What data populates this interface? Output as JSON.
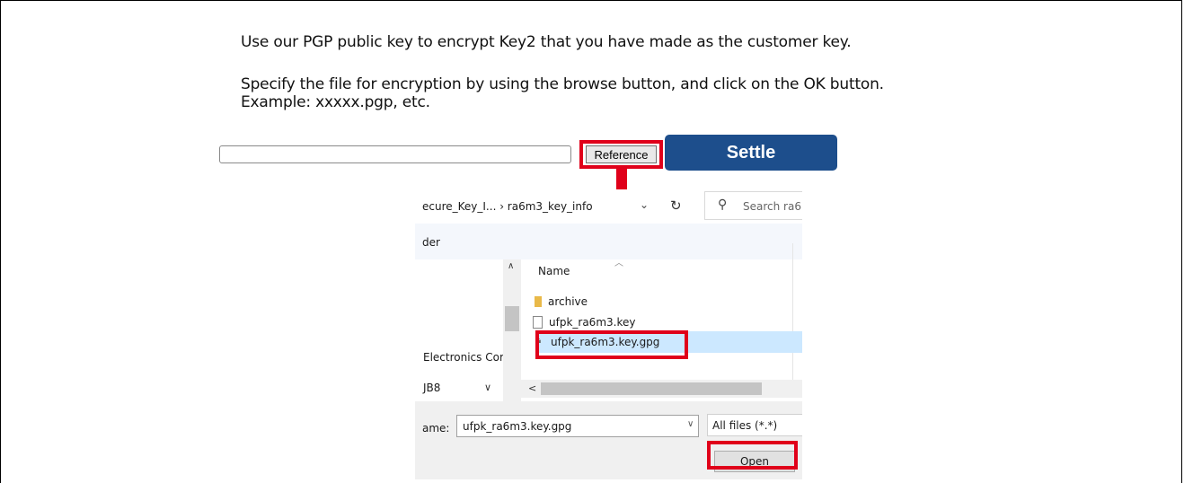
{
  "instructions": {
    "line1": "Use our PGP public key to encrypt Key2 that you have made as the customer key.",
    "line2": "Specify the file for encryption by using the browse button, and click on the OK button.",
    "line3": "Example: xxxxx.pgp, etc."
  },
  "form": {
    "file_path_value": "",
    "reference_label": "Reference",
    "settle_label": "Settle"
  },
  "colors": {
    "highlight": "#e0001a",
    "settle_bg": "#1d4e8c",
    "selected_row": "#cce8ff"
  },
  "dialog": {
    "breadcrumb": "ecure_Key_I...  ›  ra6m3_key_info",
    "search_placeholder": "Search ra6",
    "command_label": "der",
    "nav_items": [
      "Electronics Corp",
      "JB8"
    ],
    "column_name": "Name",
    "files": [
      {
        "name": "archive",
        "icon": "folder-icon"
      },
      {
        "name": "ufpk_ra6m3.key",
        "icon": "file-icon"
      },
      {
        "name": "ufpk_ra6m3.key.gpg",
        "icon": "encrypted-file-icon",
        "selected": true
      }
    ],
    "filename_label": "ame:",
    "filename_value": "ufpk_ra6m3.key.gpg",
    "filter_value": "All files (*.*)",
    "open_label": "Open"
  }
}
